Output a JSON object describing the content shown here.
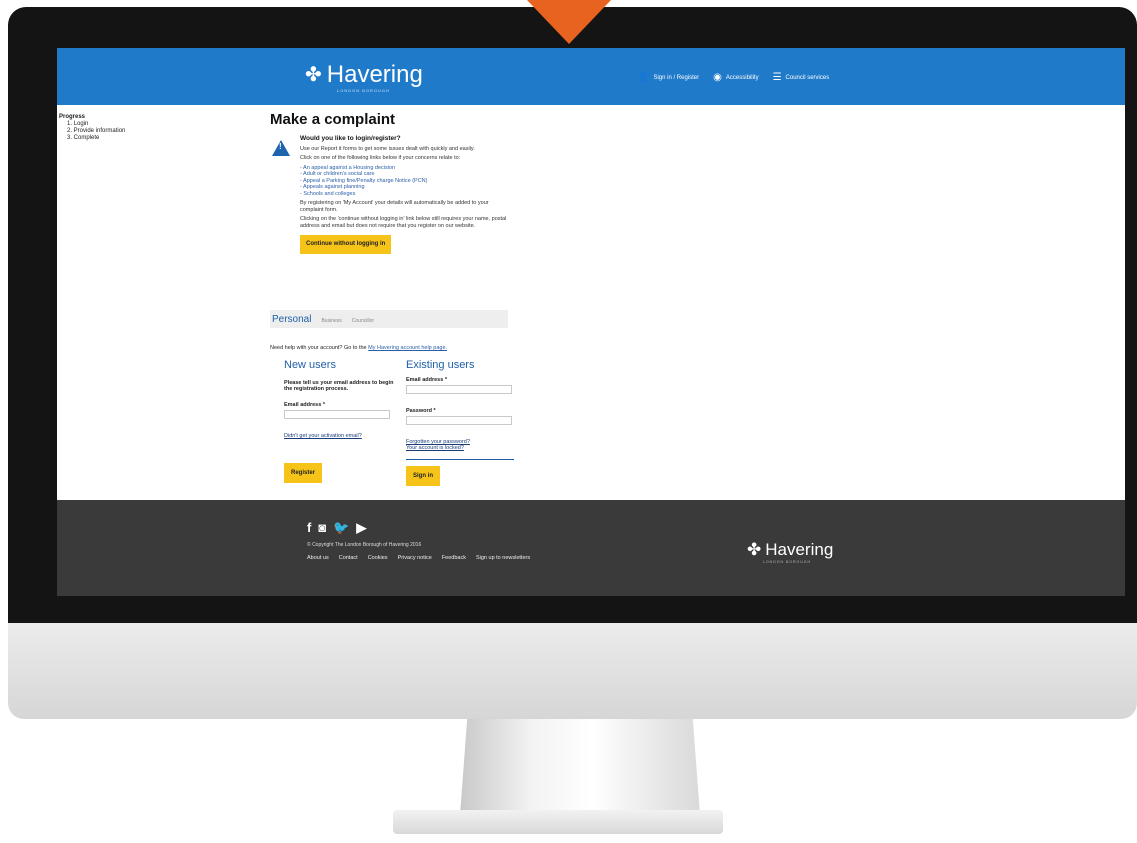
{
  "header": {
    "logo": "Havering",
    "logo_sub": "LONDON BOROUGH",
    "nav": [
      "Sign in / Register",
      "Accessibility",
      "Council services"
    ]
  },
  "progress": {
    "title": "Progress",
    "steps": [
      "1. Login",
      "2. Provide information",
      "3. Complete"
    ]
  },
  "main": {
    "title": "Make a complaint",
    "notice_title": "Would you like to login/register?",
    "notice_p1": "Use our Report it forms to get some issues dealt with quickly and easily.",
    "notice_p2": "Click on one of the following links below if your concerns relate to:",
    "links": [
      "- An appeal against a Housing decision",
      "- Adult or children's social care",
      "- Appeal a Parking fine/Penalty charge Notice (PCN)",
      "- Appeals against planning",
      "- Schools and colleges"
    ],
    "notice_p3": "By registering on 'My Account' your details will automatically be added to your complaint form.",
    "notice_p4": "Clicking on the 'continue without logging in' link below still requires your name, postal address and email but does not require that you register on our website.",
    "continue_button": "Continue without logging in"
  },
  "tabs": {
    "active": "Personal",
    "others": [
      "Business",
      "Councillor"
    ]
  },
  "help": {
    "text": "Need help with your account? Go to the",
    "link": "My Havering account help page."
  },
  "new_users": {
    "heading": "New users",
    "intro": "Please tell us your email address to begin the registration process.",
    "email_label": "Email address *",
    "activation_link": "Didn't get your activation email?",
    "register_button": "Register"
  },
  "existing_users": {
    "heading": "Existing users",
    "email_label": "Email address *",
    "password_label": "Password *",
    "forgot_link": "Forgotten your password?",
    "locked_link": "Your account is locked?",
    "signin_button": "Sign in"
  },
  "footer": {
    "copyright": "© Copyright The London Borough of Havering 2016",
    "links": [
      "About us",
      "Contact",
      "Cookies",
      "Privacy notice",
      "Feedback",
      "Sign up to newsletters"
    ],
    "logo": "Havering",
    "logo_sub": "LONDON BOROUGH"
  },
  "colors": {
    "header_blue": "#1f7ac9",
    "button_yellow": "#f6c318",
    "footer_dark": "#3a3a3a",
    "pointer_orange": "#e8631f"
  }
}
